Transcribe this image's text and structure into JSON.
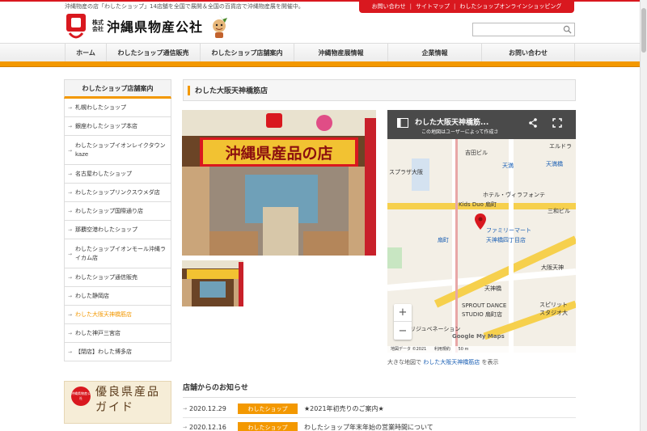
{
  "header": {
    "tagline": "沖縄物産の店「わしたショップ」14店舗を全国で展開＆全国の百貨店で沖縄物産展を開催中。",
    "top_links": [
      "お問い合わせ",
      "サイトマップ",
      "わしたショップオンラインショッピング"
    ],
    "logo_kaisha": "株式会社",
    "logo_name": "沖縄県物産公社",
    "search_placeholder": ""
  },
  "colors": {
    "red": "#d9181f",
    "orange": "#f39800"
  },
  "nav": [
    "ホーム",
    "わしたショップ通信販売",
    "わしたショップ店舗案内",
    "沖縄物産展情報",
    "企業情報",
    "お問い合わせ"
  ],
  "sidebar": {
    "title": "わしたショップ店舗案内",
    "items": [
      {
        "label": "札幌わしたショップ",
        "h": 23
      },
      {
        "label": "銀座わしたショップ本店",
        "h": 23
      },
      {
        "label": "わしたショップイオンレイクタウンkaze",
        "h": 36
      },
      {
        "label": "名古屋わしたショップ",
        "h": 23
      },
      {
        "label": "わしたショップリンクスウメダ店",
        "h": 23
      },
      {
        "label": "わしたショップ国際通り店",
        "h": 23
      },
      {
        "label": "那覇空港わしたショップ",
        "h": 23
      },
      {
        "label": "わしたショップイオンモール沖縄ライカム店",
        "h": 36
      },
      {
        "label": "わしたショップ通信販売",
        "h": 23
      },
      {
        "label": "わした静岡店",
        "h": 23
      },
      {
        "label": "わした大阪天神橋筋店",
        "h": 23,
        "active": true
      },
      {
        "label": "わした神戸三宮店",
        "h": 23
      },
      {
        "label": "【閉店】わした博多店",
        "h": 23
      }
    ],
    "banner_seal": "沖縄県物産公社",
    "banner_text": "優良県産品ガイド"
  },
  "content": {
    "title": "わした大阪天神橋筋店",
    "shop_sign": "沖縄県産品の店"
  },
  "map": {
    "title": "わした大阪天神橋筋...",
    "subtitle": "この地図はユーザーによって作成さ",
    "labels": [
      "エルドラ",
      "吉田ビル",
      "天満",
      "天満橋",
      "スプラザ大阪",
      "Kids Duo 扇町",
      "ホテル・ヴィラフォンテ",
      "三和ビル",
      "扇町",
      "ファミリーマート",
      "天神橋四丁目店",
      "大阪天神",
      "天神橋",
      "SPROUT DANCE",
      "STUDIO 扇町店",
      "スピリット",
      "スタジオ大",
      "リジュベネーション",
      "Google My Maps",
      "地図データ ©2021",
      "利用規約",
      "50 m"
    ],
    "zoom_in": "+",
    "zoom_out": "−",
    "caption_prefix": "大きな地図で",
    "caption_link": "わした大阪天神橋筋店",
    "caption_suffix": "を表示"
  },
  "news": {
    "heading": "店舗からのお知らせ",
    "items": [
      {
        "date": "2020.12.29",
        "tag": "わしたショップ",
        "title": "★2021年初売りのご案内★"
      },
      {
        "date": "2020.12.16",
        "tag": "わしたショップ",
        "title": "わしたショップ年末年始の営業時間について"
      }
    ]
  }
}
